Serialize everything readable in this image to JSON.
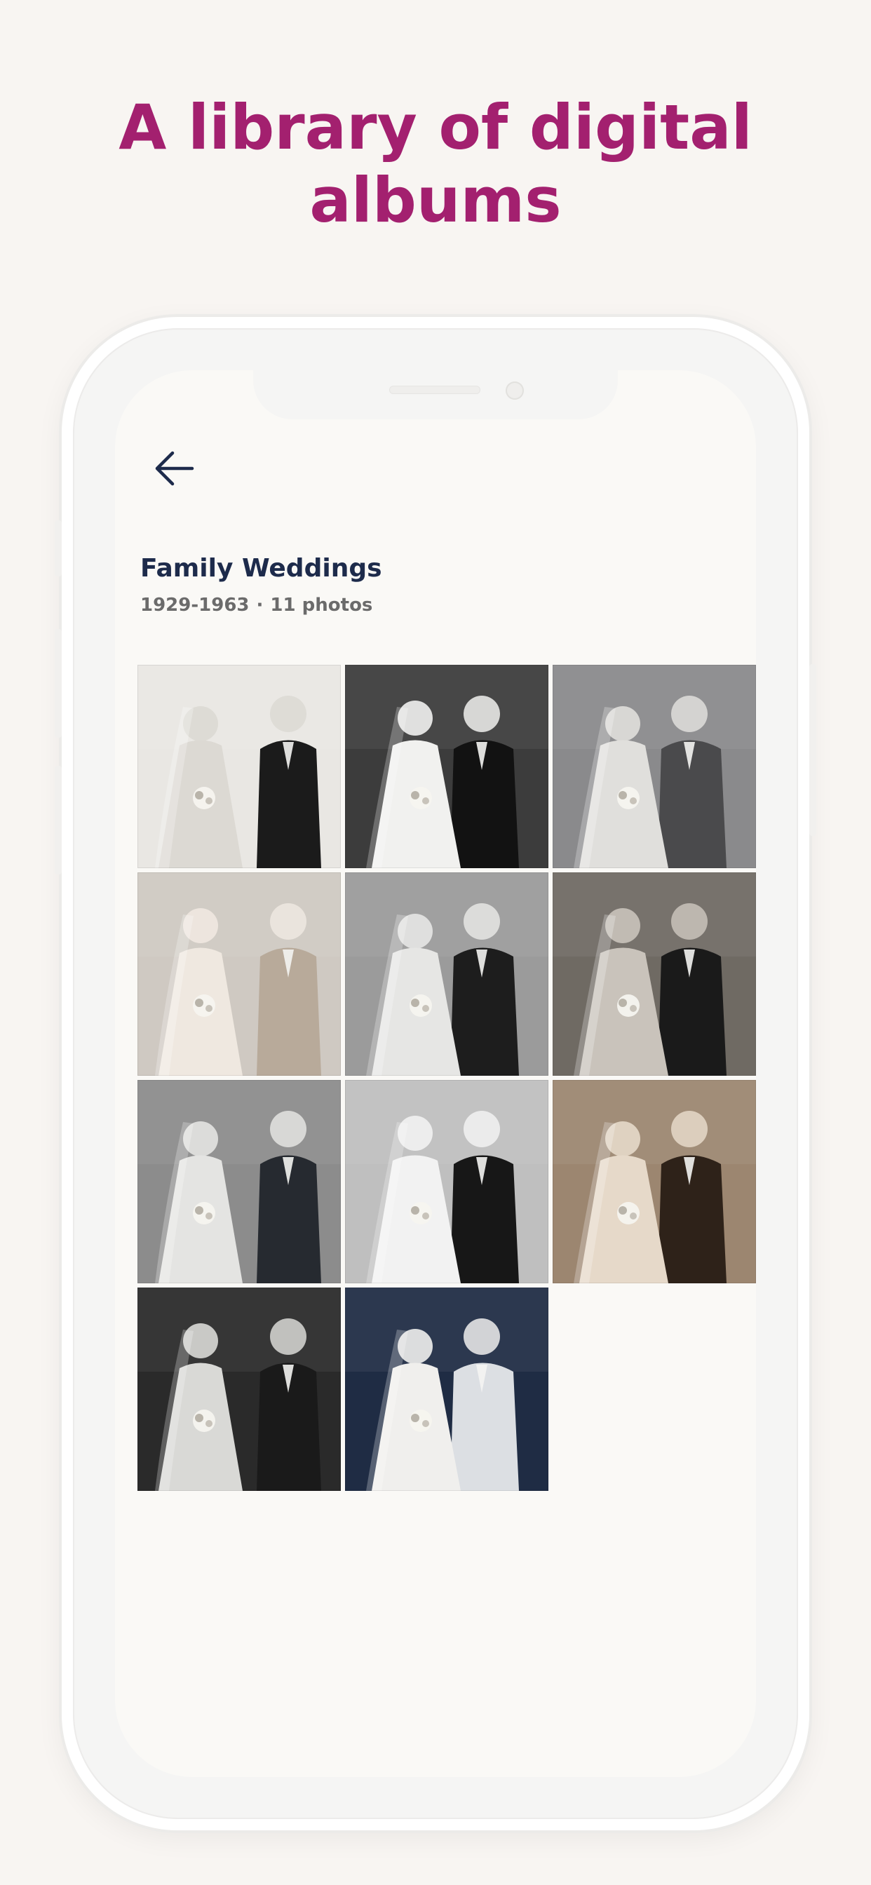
{
  "headline": "A library of digital albums",
  "album": {
    "title": "Family Weddings",
    "years": "1929-1963",
    "separator": "·",
    "count": "11 photos"
  },
  "back_icon": "arrow-left-icon",
  "photos": [
    {
      "tone": "bw",
      "bg": "#e9e7e3",
      "fig": "#1b1b1b",
      "dress": "#dcd9d3"
    },
    {
      "tone": "bw",
      "bg": "#3c3c3c",
      "fig": "#121212",
      "dress": "#f1f1ef"
    },
    {
      "tone": "bw",
      "bg": "#8a8a8c",
      "fig": "#4a4a4c",
      "dress": "#e0dfdc"
    },
    {
      "tone": "bw",
      "bg": "#cfc9c2",
      "fig": "#b8aa9a",
      "dress": "#efe8e0"
    },
    {
      "tone": "bw",
      "bg": "#9b9b9b",
      "fig": "#1d1d1d",
      "dress": "#e6e6e4"
    },
    {
      "tone": "bw",
      "bg": "#6f6a63",
      "fig": "#1a1a1a",
      "dress": "#c9c3bb"
    },
    {
      "tone": "bw",
      "bg": "#8c8c8c",
      "fig": "#262a30",
      "dress": "#e4e4e2"
    },
    {
      "tone": "bw",
      "bg": "#bfbfbf",
      "fig": "#171717",
      "dress": "#f2f2f2"
    },
    {
      "tone": "sepia",
      "bg": "#9c8670",
      "fig": "#2e2219",
      "dress": "#e6d9c9"
    },
    {
      "tone": "bw",
      "bg": "#2a2a2a",
      "fig": "#1a1a1a",
      "dress": "#d9d9d6"
    },
    {
      "tone": "navy",
      "bg": "#1f2c44",
      "fig": "#dcdfe3",
      "dress": "#f0efed"
    }
  ]
}
